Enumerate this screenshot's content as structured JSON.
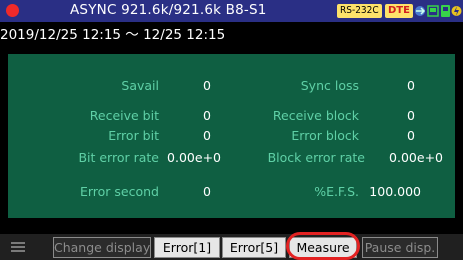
{
  "titlebar": {
    "title": "ASYNC 921.6k/921.6k B8-S1",
    "badge_interface": "RS-232C",
    "badge_mode": "DTE",
    "icons": [
      "record-dot-icon",
      "connection-arrow-icon",
      "pc-link-icon",
      "memory-card-icon",
      "power-icon"
    ]
  },
  "period": "2019/12/25 12:15 〜 12/25 12:15",
  "stats": {
    "savail": {
      "label": "Savail",
      "value": "0"
    },
    "sync_loss": {
      "label": "Sync loss",
      "value": "0"
    },
    "receive_bit": {
      "label": "Receive bit",
      "value": "0"
    },
    "receive_block": {
      "label": "Receive block",
      "value": "0"
    },
    "error_bit": {
      "label": "Error bit",
      "value": "0"
    },
    "error_block": {
      "label": "Error block",
      "value": "0"
    },
    "bit_error_rate": {
      "label": "Bit error rate",
      "value": "0.00e+0"
    },
    "block_error_rate": {
      "label": "Block error rate",
      "value": "0.00e+0"
    },
    "error_second": {
      "label": "Error second",
      "value": "0"
    },
    "efs": {
      "label": "%E.F.S.",
      "value": "100.000"
    }
  },
  "softkeys": {
    "change_display": "Change display",
    "error1": "Error[1]",
    "error5": "Error[5]",
    "measure": "Measure",
    "pause_disp": "Pause disp."
  },
  "colors": {
    "titlebar": "#2a2f85",
    "panel": "#0f5f42",
    "label_text": "#5fd0a6",
    "badge": "#fde26a",
    "record": "#f02a2a",
    "highlight": "#e32222"
  }
}
